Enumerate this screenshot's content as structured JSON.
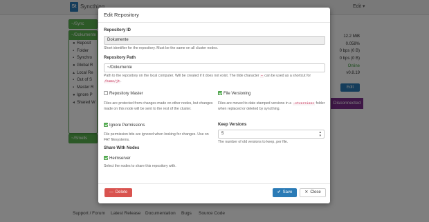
{
  "navbar": {
    "brand": "Syncthing",
    "edit_menu": "Edit ▾",
    "logo": "St"
  },
  "repos_bg": {
    "repo1_title": "~/Sync",
    "repo2_title": "~/Dokumente",
    "repo3_title": "~/Smells",
    "rows": [
      "Reposit",
      "Folder",
      "Synchro",
      "Global R",
      "Local Re",
      "Out of S",
      "Master R",
      "Ignore P",
      "Shared W"
    ]
  },
  "stats_bg": [
    "12.2 MiB",
    "0.058%",
    "0 bps (0 B)",
    "0 bps (0 B)",
    "Online",
    "v0.8.19"
  ],
  "bg_buttons": {
    "edit": "Edit",
    "disconnected": "Disconnected"
  },
  "modal": {
    "title": "Edit Repository",
    "repo_id": {
      "label": "Repository ID",
      "value": "Dokumente",
      "help": "Short identifier for the repository. Must be the same on all cluster nodes."
    },
    "repo_path": {
      "label": "Repository Path",
      "value": "~/Dokumente",
      "help_before": "Path to the repository on the local computer. Will be created if it does not exist. The tilde character",
      "help_tilde": "~",
      "help_middle": "can be used as a shortcut for",
      "help_code": "/home/jt",
      "help_after": "."
    },
    "repo_master": {
      "label": "Repository Master",
      "checked": false,
      "help": "Files are protected from changes made on other nodes, but changes made on this node will be sent to the rest of the cluster."
    },
    "file_versioning": {
      "label": "File Versioning",
      "checked": true,
      "help_before": "Files are moved to date stamped versions in a",
      "help_code": ".stversions",
      "help_after": "folder when replaced or deleted by syncthing."
    },
    "ignore_permissions": {
      "label": "Ignore Permissions",
      "checked": true,
      "help": "File permission bits are ignored when looking for changes. Use on FAT filesystems."
    },
    "keep_versions": {
      "label": "Keep Versions",
      "value": "5",
      "help": "The number of old versions to keep, per file."
    },
    "share_with": {
      "label": "Share With Nodes",
      "node": "Heimserver",
      "checked": true,
      "help": "Select the nodes to share this repository with."
    },
    "buttons": {
      "delete": "Delete",
      "save": "Save",
      "close": "Close"
    }
  },
  "footer": [
    "Support / Forum",
    "Latest Release",
    "Documentation",
    "Bugs",
    "Source Code"
  ]
}
